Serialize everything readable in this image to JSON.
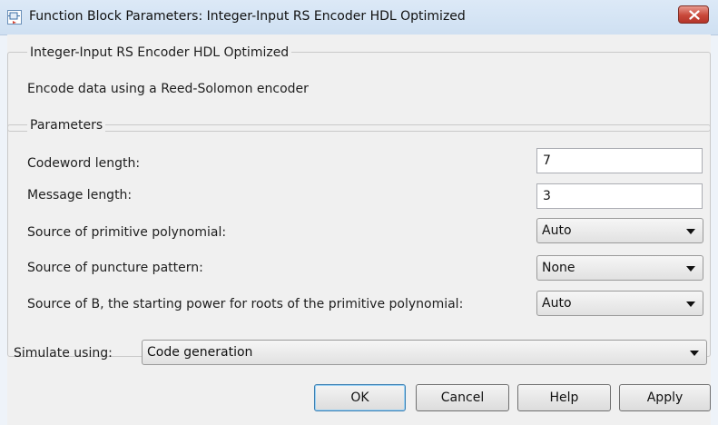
{
  "window": {
    "title": "Function Block Parameters: Integer-Input RS Encoder HDL Optimized"
  },
  "block": {
    "group_title": "Integer-Input RS Encoder HDL Optimized",
    "description": "Encode data using a Reed-Solomon encoder"
  },
  "parameters": {
    "group_title": "Parameters",
    "codeword_length": {
      "label": "Codeword length:",
      "value": "7"
    },
    "message_length": {
      "label": "Message length:",
      "value": "3"
    },
    "primitive_polynomial_source": {
      "label": "Source of primitive polynomial:",
      "value": "Auto"
    },
    "puncture_pattern_source": {
      "label": "Source of puncture pattern:",
      "value": "None"
    },
    "b_source": {
      "label": "Source of B, the starting power for roots of the primitive polynomial:",
      "value": "Auto"
    }
  },
  "simulate": {
    "label": "Simulate using:",
    "value": "Code generation"
  },
  "buttons": {
    "ok": "OK",
    "cancel": "Cancel",
    "help": "Help",
    "apply": "Apply"
  },
  "colors": {
    "close_button": "#c8483a",
    "titlebar": "#dce9f7",
    "default_button_border": "#3c7fb1"
  },
  "icons": {
    "app": "simulink-block-icon",
    "close": "close-icon",
    "dropdown": "chevron-down-icon"
  }
}
